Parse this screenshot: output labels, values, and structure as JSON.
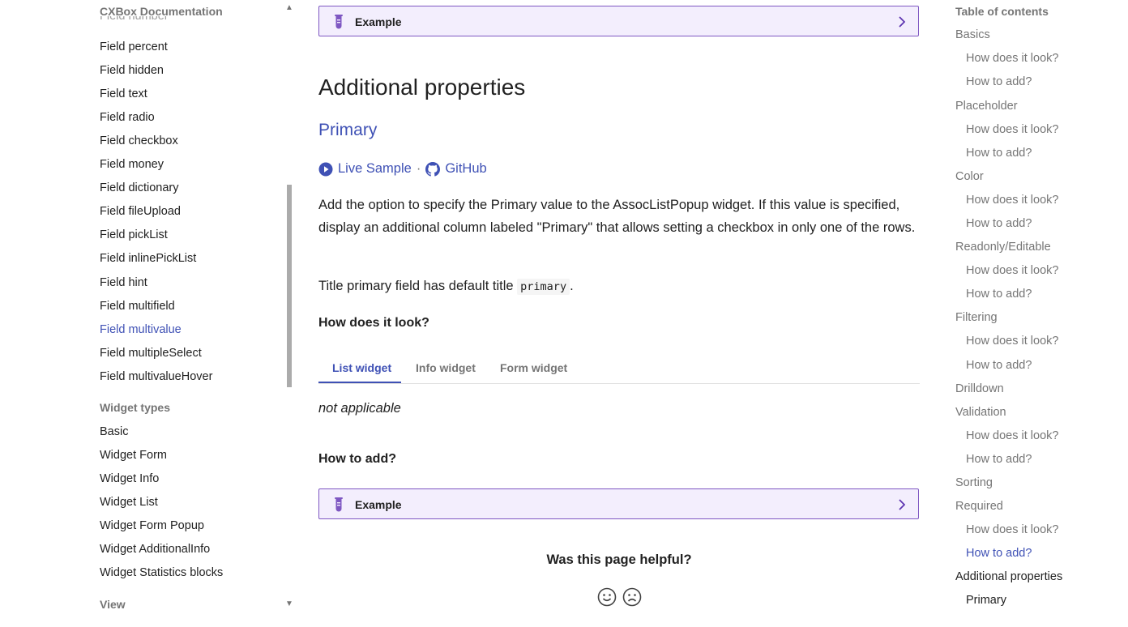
{
  "sidebar": {
    "title": "CXBox Documentation",
    "cut_item": "Field number",
    "field_items": [
      {
        "label": "Field percent"
      },
      {
        "label": "Field hidden"
      },
      {
        "label": "Field text"
      },
      {
        "label": "Field radio"
      },
      {
        "label": "Field checkbox"
      },
      {
        "label": "Field money"
      },
      {
        "label": "Field dictionary"
      },
      {
        "label": "Field fileUpload"
      },
      {
        "label": "Field pickList"
      },
      {
        "label": "Field inlinePickList"
      },
      {
        "label": "Field hint"
      },
      {
        "label": "Field multifield"
      },
      {
        "label": "Field multivalue",
        "active": true
      },
      {
        "label": "Field multipleSelect"
      },
      {
        "label": "Field multivalueHover"
      }
    ],
    "widget_section": "Widget types",
    "widget_items": [
      {
        "label": "Basic"
      },
      {
        "label": "Widget Form"
      },
      {
        "label": "Widget Info"
      },
      {
        "label": "Widget List"
      },
      {
        "label": "Widget Form Popup"
      },
      {
        "label": "Widget AdditionalInfo"
      },
      {
        "label": "Widget Statistics blocks"
      }
    ],
    "view_section": "View"
  },
  "main": {
    "example_label": "Example",
    "additional_heading": "Additional properties",
    "primary_heading": "Primary",
    "live_sample": "Live Sample",
    "separator": "·",
    "github": "GitHub",
    "description": "Add the option to specify the Primary value to the AssocListPopup widget. If this value is specified, display an additional column labeled \"Primary\" that allows setting a checkbox in only one of the rows.",
    "title_text_before": "Title primary field has default title",
    "title_code": "primary",
    "title_text_after": ".",
    "how_look": "How does it look?",
    "tabs": [
      {
        "label": "List widget",
        "active": true
      },
      {
        "label": "Info widget"
      },
      {
        "label": "Form widget"
      }
    ],
    "not_applicable": "not applicable",
    "how_add": "How to add?",
    "feedback_question": "Was this page helpful?"
  },
  "toc": {
    "title": "Table of contents",
    "items": [
      {
        "label": "Basics",
        "level": 1
      },
      {
        "label": "How does it look?",
        "level": 2
      },
      {
        "label": "How to add?",
        "level": 2
      },
      {
        "label": "Placeholder",
        "level": 1
      },
      {
        "label": "How does it look?",
        "level": 2
      },
      {
        "label": "How to add?",
        "level": 2
      },
      {
        "label": "Color",
        "level": 1
      },
      {
        "label": "How does it look?",
        "level": 2
      },
      {
        "label": "How to add?",
        "level": 2
      },
      {
        "label": "Readonly/Editable",
        "level": 1
      },
      {
        "label": "How does it look?",
        "level": 2
      },
      {
        "label": "How to add?",
        "level": 2
      },
      {
        "label": "Filtering",
        "level": 1
      },
      {
        "label": "How does it look?",
        "level": 2
      },
      {
        "label": "How to add?",
        "level": 2
      },
      {
        "label": "Drilldown",
        "level": 1
      },
      {
        "label": "Validation",
        "level": 1
      },
      {
        "label": "How does it look?",
        "level": 2
      },
      {
        "label": "How to add?",
        "level": 2
      },
      {
        "label": "Sorting",
        "level": 1
      },
      {
        "label": "Required",
        "level": 1
      },
      {
        "label": "How does it look?",
        "level": 2
      },
      {
        "label": "How to add?",
        "level": 2,
        "active": true
      },
      {
        "label": "Additional properties",
        "level": 1,
        "current": true
      },
      {
        "label": "Primary",
        "level": 2,
        "current": true
      }
    ]
  },
  "colors": {
    "accent": "#3f51b5",
    "example_border": "#7e57c2",
    "example_bg": "#f3eefd",
    "muted": "#757575"
  },
  "icons": [
    "beaker-icon",
    "chevron-right-icon",
    "play-circle-icon",
    "github-icon",
    "smile-icon",
    "frown-icon",
    "caret-up-icon",
    "caret-down-icon"
  ]
}
